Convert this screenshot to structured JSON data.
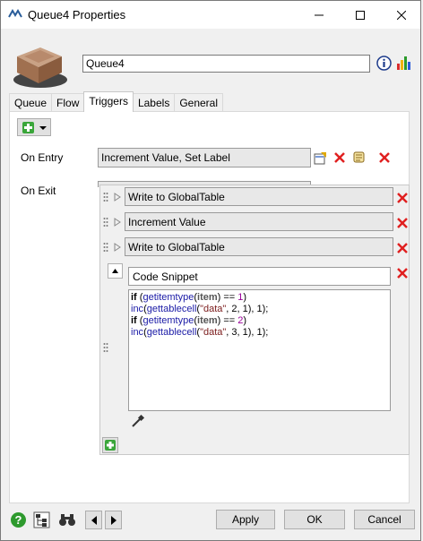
{
  "window": {
    "title": "Queue4  Properties"
  },
  "header": {
    "name_value": "Queue4"
  },
  "tabs": [
    {
      "label": "Queue"
    },
    {
      "label": "Flow"
    },
    {
      "label": "Triggers"
    },
    {
      "label": "Labels"
    },
    {
      "label": "General"
    }
  ],
  "triggers": {
    "on_entry_label": "On Entry",
    "on_entry_value": "Increment Value, Set Label",
    "on_exit_label": "On Exit"
  },
  "popup": {
    "rows": [
      {
        "label": "Write to GlobalTable"
      },
      {
        "label": "Increment Value"
      },
      {
        "label": "Write to GlobalTable"
      }
    ],
    "code_title": "Code Snippet",
    "code_lines": [
      [
        "if",
        " (",
        "getitemtype",
        "(",
        "item",
        ") == ",
        "1",
        ")"
      ],
      [
        "",
        "",
        "inc",
        "(",
        "gettablecell",
        "(",
        "\"data\"",
        ", 2, 1), 1);"
      ],
      [
        "if",
        " (",
        "getitemtype",
        "(",
        "item",
        ") == ",
        "2",
        ")"
      ],
      [
        "",
        "",
        "inc",
        "(",
        "gettablecell",
        "(",
        "\"data\"",
        ", 3, 1), 1);"
      ]
    ]
  },
  "buttons": {
    "apply": "Apply",
    "ok": "OK",
    "cancel": "Cancel"
  },
  "icons": {
    "accent_green": "#3aa63a",
    "accent_red": "#e02020"
  }
}
